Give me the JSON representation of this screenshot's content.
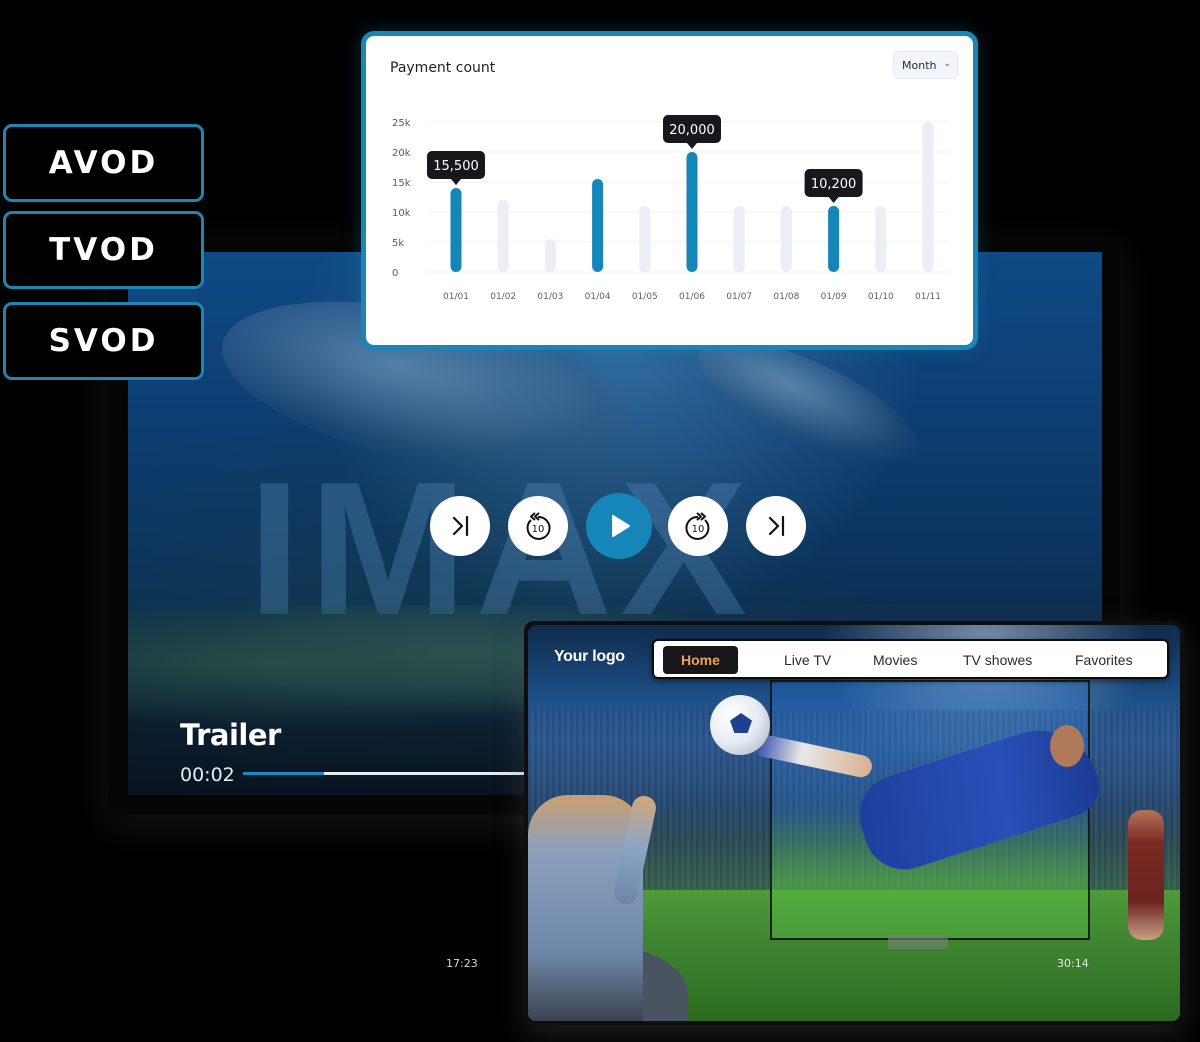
{
  "vod_badges": [
    {
      "label": "AVOD"
    },
    {
      "label": "TVOD"
    },
    {
      "label": "SVOD"
    }
  ],
  "chart_card": {
    "title": "Payment count",
    "period_select": {
      "value": "Month",
      "icon": "chevron-down-icon"
    }
  },
  "chart_data": {
    "type": "bar",
    "title": "Payment count",
    "xlabel": "",
    "ylabel": "",
    "categories": [
      "01/01",
      "01/02",
      "01/03",
      "01/04",
      "01/05",
      "01/06",
      "01/07",
      "01/08",
      "01/09",
      "01/10",
      "01/11"
    ],
    "values": [
      14000,
      12000,
      5500,
      15500,
      11000,
      20000,
      11000,
      11000,
      11000,
      11000,
      25000
    ],
    "highlighted": [
      true,
      false,
      false,
      true,
      false,
      true,
      false,
      false,
      true,
      false,
      false
    ],
    "data_labels": [
      {
        "category": "01/01",
        "text": "15,500"
      },
      {
        "category": "01/06",
        "text": "20,000"
      },
      {
        "category": "01/09",
        "text": "10,200"
      }
    ],
    "yticks": [
      0,
      5000,
      10000,
      15000,
      20000,
      25000
    ],
    "ytick_labels": [
      "0",
      "5k",
      "10k",
      "15k",
      "20k",
      "25k"
    ],
    "ylim": [
      0,
      25000
    ],
    "grid": true,
    "colors": {
      "highlight": "#1686b8",
      "muted": "#ecedf5"
    }
  },
  "player": {
    "title": "Trailer",
    "current_time": "00:02",
    "progress_fraction": 0.27,
    "controls": [
      {
        "name": "skip-previous-button",
        "icon": "skip-icon"
      },
      {
        "name": "rewind-10-button",
        "icon": "rewind-10-icon",
        "text": "10"
      },
      {
        "name": "play-button",
        "icon": "play-icon"
      },
      {
        "name": "forward-10-button",
        "icon": "forward-10-icon",
        "text": "10"
      },
      {
        "name": "skip-next-button",
        "icon": "skip-icon"
      }
    ],
    "background_text": "IMAX",
    "extra_time": "17:23"
  },
  "tv_app": {
    "logo": "Your logo",
    "nav": [
      {
        "label": "Home",
        "active": true
      },
      {
        "label": "Live TV",
        "active": false
      },
      {
        "label": "Movies",
        "active": false
      },
      {
        "label": "TV showes",
        "active": false
      },
      {
        "label": "Favorites",
        "active": false
      }
    ],
    "time": "30:14"
  },
  "colors": {
    "accent": "#1a86b6",
    "nav_active_text": "#f0a060"
  }
}
